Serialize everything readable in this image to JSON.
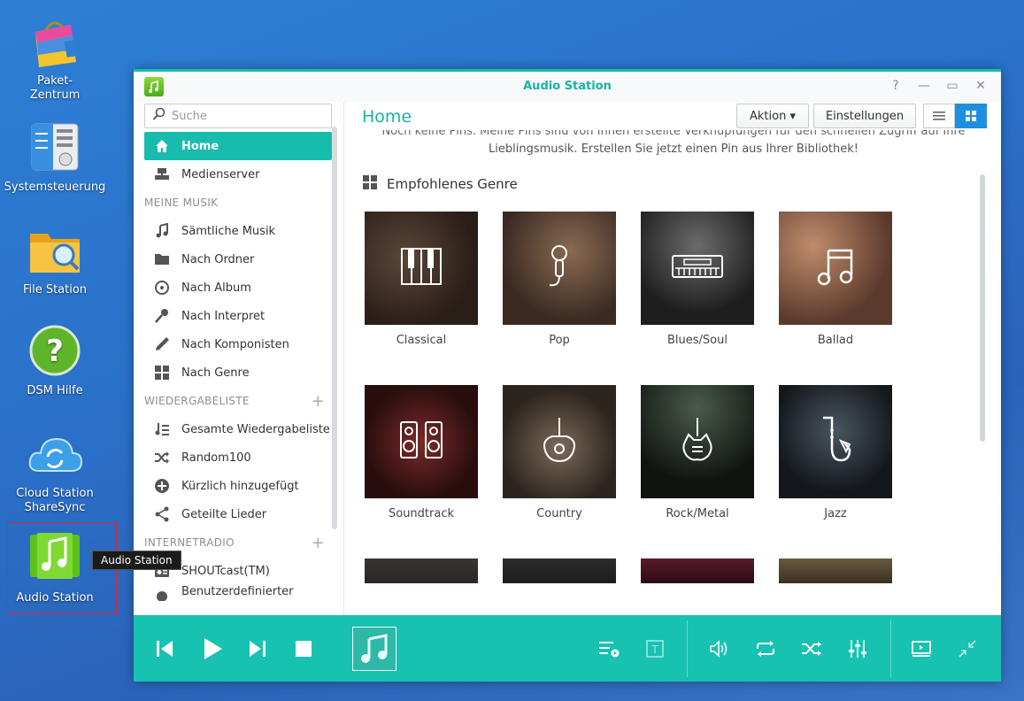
{
  "desktop": {
    "icons": [
      {
        "label": "Paket-\nZentrum",
        "line1": "Paket-",
        "line2": "Zentrum"
      },
      {
        "label": "Systemsteuerung"
      },
      {
        "label": "File Station"
      },
      {
        "label": "DSM Hilfe"
      },
      {
        "line1": "Cloud Station",
        "line2": "ShareSync"
      },
      {
        "label": "Audio Station"
      }
    ],
    "tooltip": "Audio Station"
  },
  "window": {
    "title": "Audio Station",
    "controls": {
      "help": "?",
      "minimize": "—",
      "maximize": "▭",
      "close": "✕"
    }
  },
  "sidebar": {
    "search_placeholder": "Suche",
    "items": [
      {
        "label": "Home"
      },
      {
        "label": "Medienserver"
      }
    ],
    "sections": [
      {
        "title": "MEINE MUSIK",
        "items": [
          "Sämtliche Musik",
          "Nach Ordner",
          "Nach Album",
          "Nach Interpret",
          "Nach Komponisten",
          "Nach Genre"
        ]
      },
      {
        "title": "WIEDERGABELISTE",
        "items": [
          "Gesamte Wiedergabeliste",
          "Random100",
          "Kürzlich hinzugefügt",
          "Geteilte Lieder"
        ]
      },
      {
        "title": "INTERNETRADIO",
        "items": [
          "SHOUTcast(TM)",
          "Benutzerdefinierter"
        ]
      }
    ]
  },
  "main": {
    "title": "Home",
    "buttons": {
      "action": "Aktion ▾",
      "settings": "Einstellungen"
    },
    "info_line1": "Noch keine Pins. Meine Pins sind von Ihnen erstellte Verknüpfungen für den schnellen Zugriff auf Ihre",
    "info_line2": "Lieblingsmusik. Erstellen Sie jetzt einen Pin aus Ihrer Bibliothek!",
    "section_title": "Empfohlenes Genre",
    "genres": [
      "Classical",
      "Pop",
      "Blues/Soul",
      "Ballad",
      "Soundtrack",
      "Country",
      "Rock/Metal",
      "Jazz"
    ]
  },
  "player": {
    "controls": [
      "previous",
      "play",
      "next",
      "stop"
    ],
    "right_controls": [
      "playlist-icon",
      "lyrics-icon",
      "volume-icon",
      "repeat-icon",
      "shuffle-icon",
      "equalizer-icon",
      "output-icon",
      "minimize-player-icon"
    ]
  },
  "colors": {
    "accent": "#18bcad",
    "player_bg": "#17c2b1",
    "view_active": "#1e8fe0"
  }
}
